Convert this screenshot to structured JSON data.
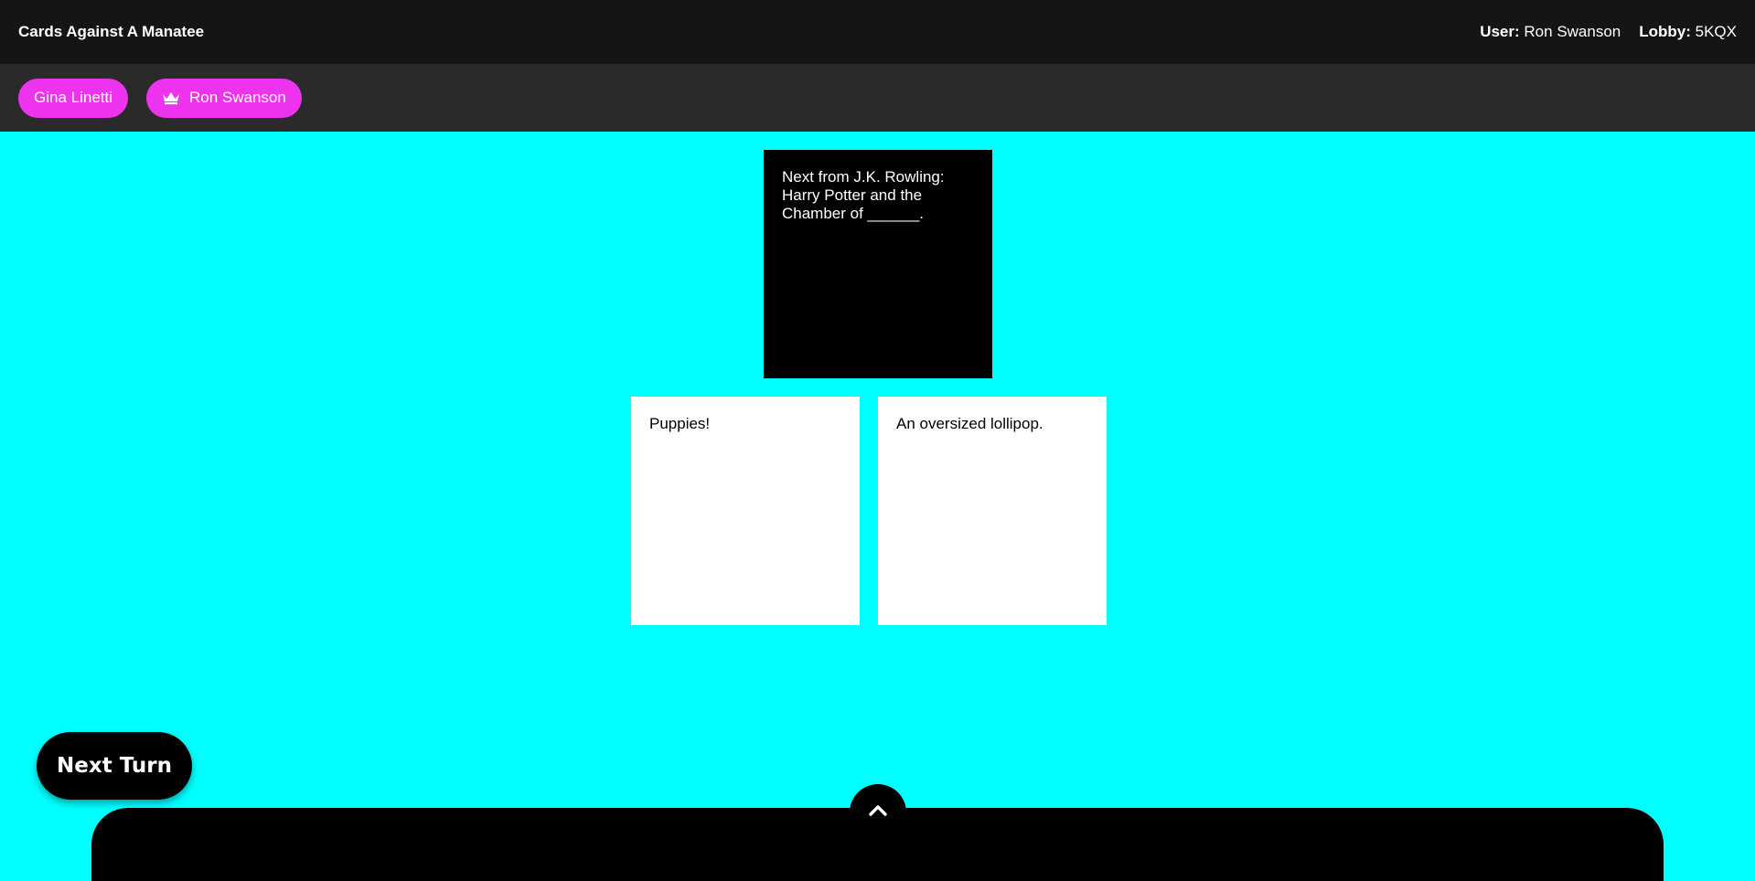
{
  "header": {
    "app_title": "Cards Against A Manatee",
    "user_label": "User:",
    "user_name": "Ron Swanson",
    "lobby_label": "Lobby:",
    "lobby_code": "5KQX"
  },
  "players": [
    {
      "name": "Gina Linetti",
      "is_czar": false
    },
    {
      "name": "Ron Swanson",
      "is_czar": true,
      "icon": "crown-icon"
    }
  ],
  "black_card": {
    "text": "Next from J.K. Rowling: Harry Potter and the Chamber of ______."
  },
  "white_cards": [
    {
      "text": "Puppies!"
    },
    {
      "text": "An oversized lollipop."
    }
  ],
  "actions": {
    "next_turn_label": "Next Turn",
    "tray_toggle_icon": "chevron-up-icon"
  },
  "colors": {
    "background": "#00ffff",
    "topbar": "#151515",
    "playerbar": "#2a2a2a",
    "player_pill": "#ee33ee"
  }
}
